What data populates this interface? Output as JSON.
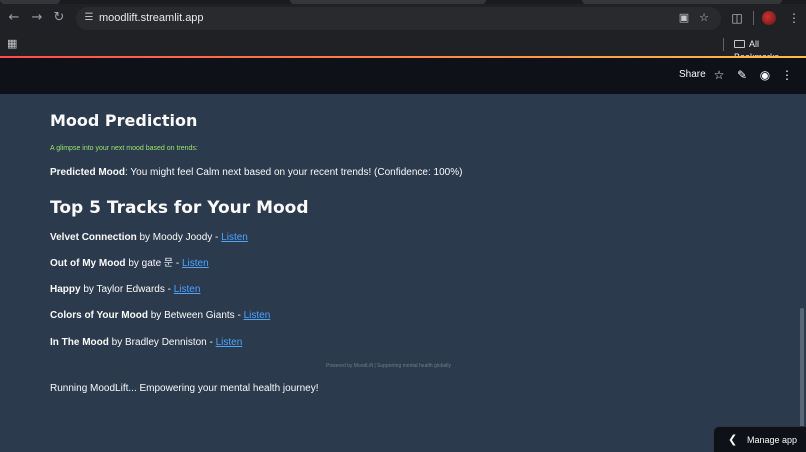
{
  "browser": {
    "url": "moodlift.streamlit.app",
    "bookmarks_folder": "All Bookmarks",
    "icons": {
      "back": "arrow-left-icon",
      "forward": "arrow-right-icon",
      "reload": "reload-icon",
      "site_info": "tune-icon",
      "install": "install-app-icon",
      "bookmark_star": "star-icon",
      "extensions": "puzzle-icon",
      "profile": "avatar",
      "menu": "kebab-menu-icon",
      "apps": "apps-grid-icon"
    }
  },
  "app_header": {
    "share_label": "Share",
    "icons": [
      "star-icon",
      "pencil-icon",
      "github-icon",
      "kebab-menu-icon"
    ]
  },
  "main": {
    "prediction": {
      "heading": "Mood Prediction",
      "caption": "A glimpse into your next mood based on trends:",
      "label": "Predicted Mood",
      "text": ": You might feel Calm next based on your recent trends! (Confidence: 100%)"
    },
    "tracks": {
      "heading": "Top 5 Tracks for Your Mood",
      "listen_label": "Listen",
      "items": [
        {
          "title": "Velvet Connection",
          "artist": " by Moody Joody - "
        },
        {
          "title": "Out of My Mood",
          "artist": " by gate 문 - "
        },
        {
          "title": "Happy",
          "artist": " by Taylor Edwards - "
        },
        {
          "title": "Colors of Your Mood",
          "artist": " by Between Giants - "
        },
        {
          "title": "In The Mood",
          "artist": " by Bradley Denniston - "
        }
      ]
    },
    "footer_note": "Powered by MoodLift | Supporting mental health globally",
    "running_text": "Running MoodLift... Empowering your mental health journey!"
  },
  "manage_app": {
    "label": "Manage app"
  },
  "colors": {
    "background": "#2b3a4d",
    "header": "#0e1117",
    "caption": "#9be66c",
    "link": "#4da3ff",
    "accent_gradient_start": "#ff4b4b",
    "accent_gradient_end": "#ffbd45"
  }
}
